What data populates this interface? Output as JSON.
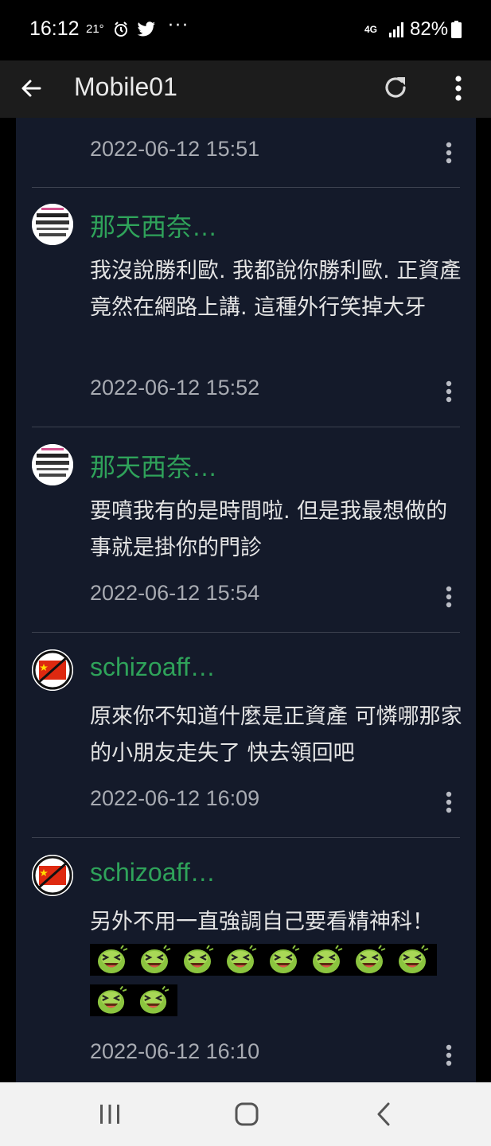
{
  "status_bar": {
    "time": "16:12",
    "temperature": "21°",
    "more": "···",
    "network": "4G",
    "battery": "82%"
  },
  "app_bar": {
    "title": "Mobile01",
    "back_icon": "arrow-left-icon",
    "refresh_icon": "refresh-icon",
    "overflow_icon": "more-vertical-icon"
  },
  "comments": [
    {
      "name": "",
      "body": "",
      "date": "2022-06-12 15:51"
    },
    {
      "name": "那天西奈…",
      "body": "我沒說勝利歐. 我都說你勝利歐. 正資產竟然在網路上講. 這種外行笑掉大牙",
      "date": "2022-06-12 15:52"
    },
    {
      "name": "那天西奈…",
      "body": "要噴我有的是時間啦. 但是我最想做的事就是掛你的門診",
      "date": "2022-06-12 15:54"
    },
    {
      "name": "schizoaff…",
      "body": "原來你不知道什麼是正資產 可憐哪那家的小朋友走失了 快去領回吧",
      "date": "2022-06-12 16:09"
    },
    {
      "name": "schizoaff…",
      "body": "另外不用一直強調自己要看精神科！",
      "date": "2022-06-12 16:10",
      "emoji_count": 10
    }
  ],
  "nav_bar": {
    "recents_icon": "recents-icon",
    "home_icon": "home-icon",
    "back_icon": "back-chevron-icon"
  },
  "colors": {
    "panel": "#141a2a",
    "username": "#2fa35a",
    "date": "#a8abb2",
    "body_text": "#e4e4e4"
  }
}
